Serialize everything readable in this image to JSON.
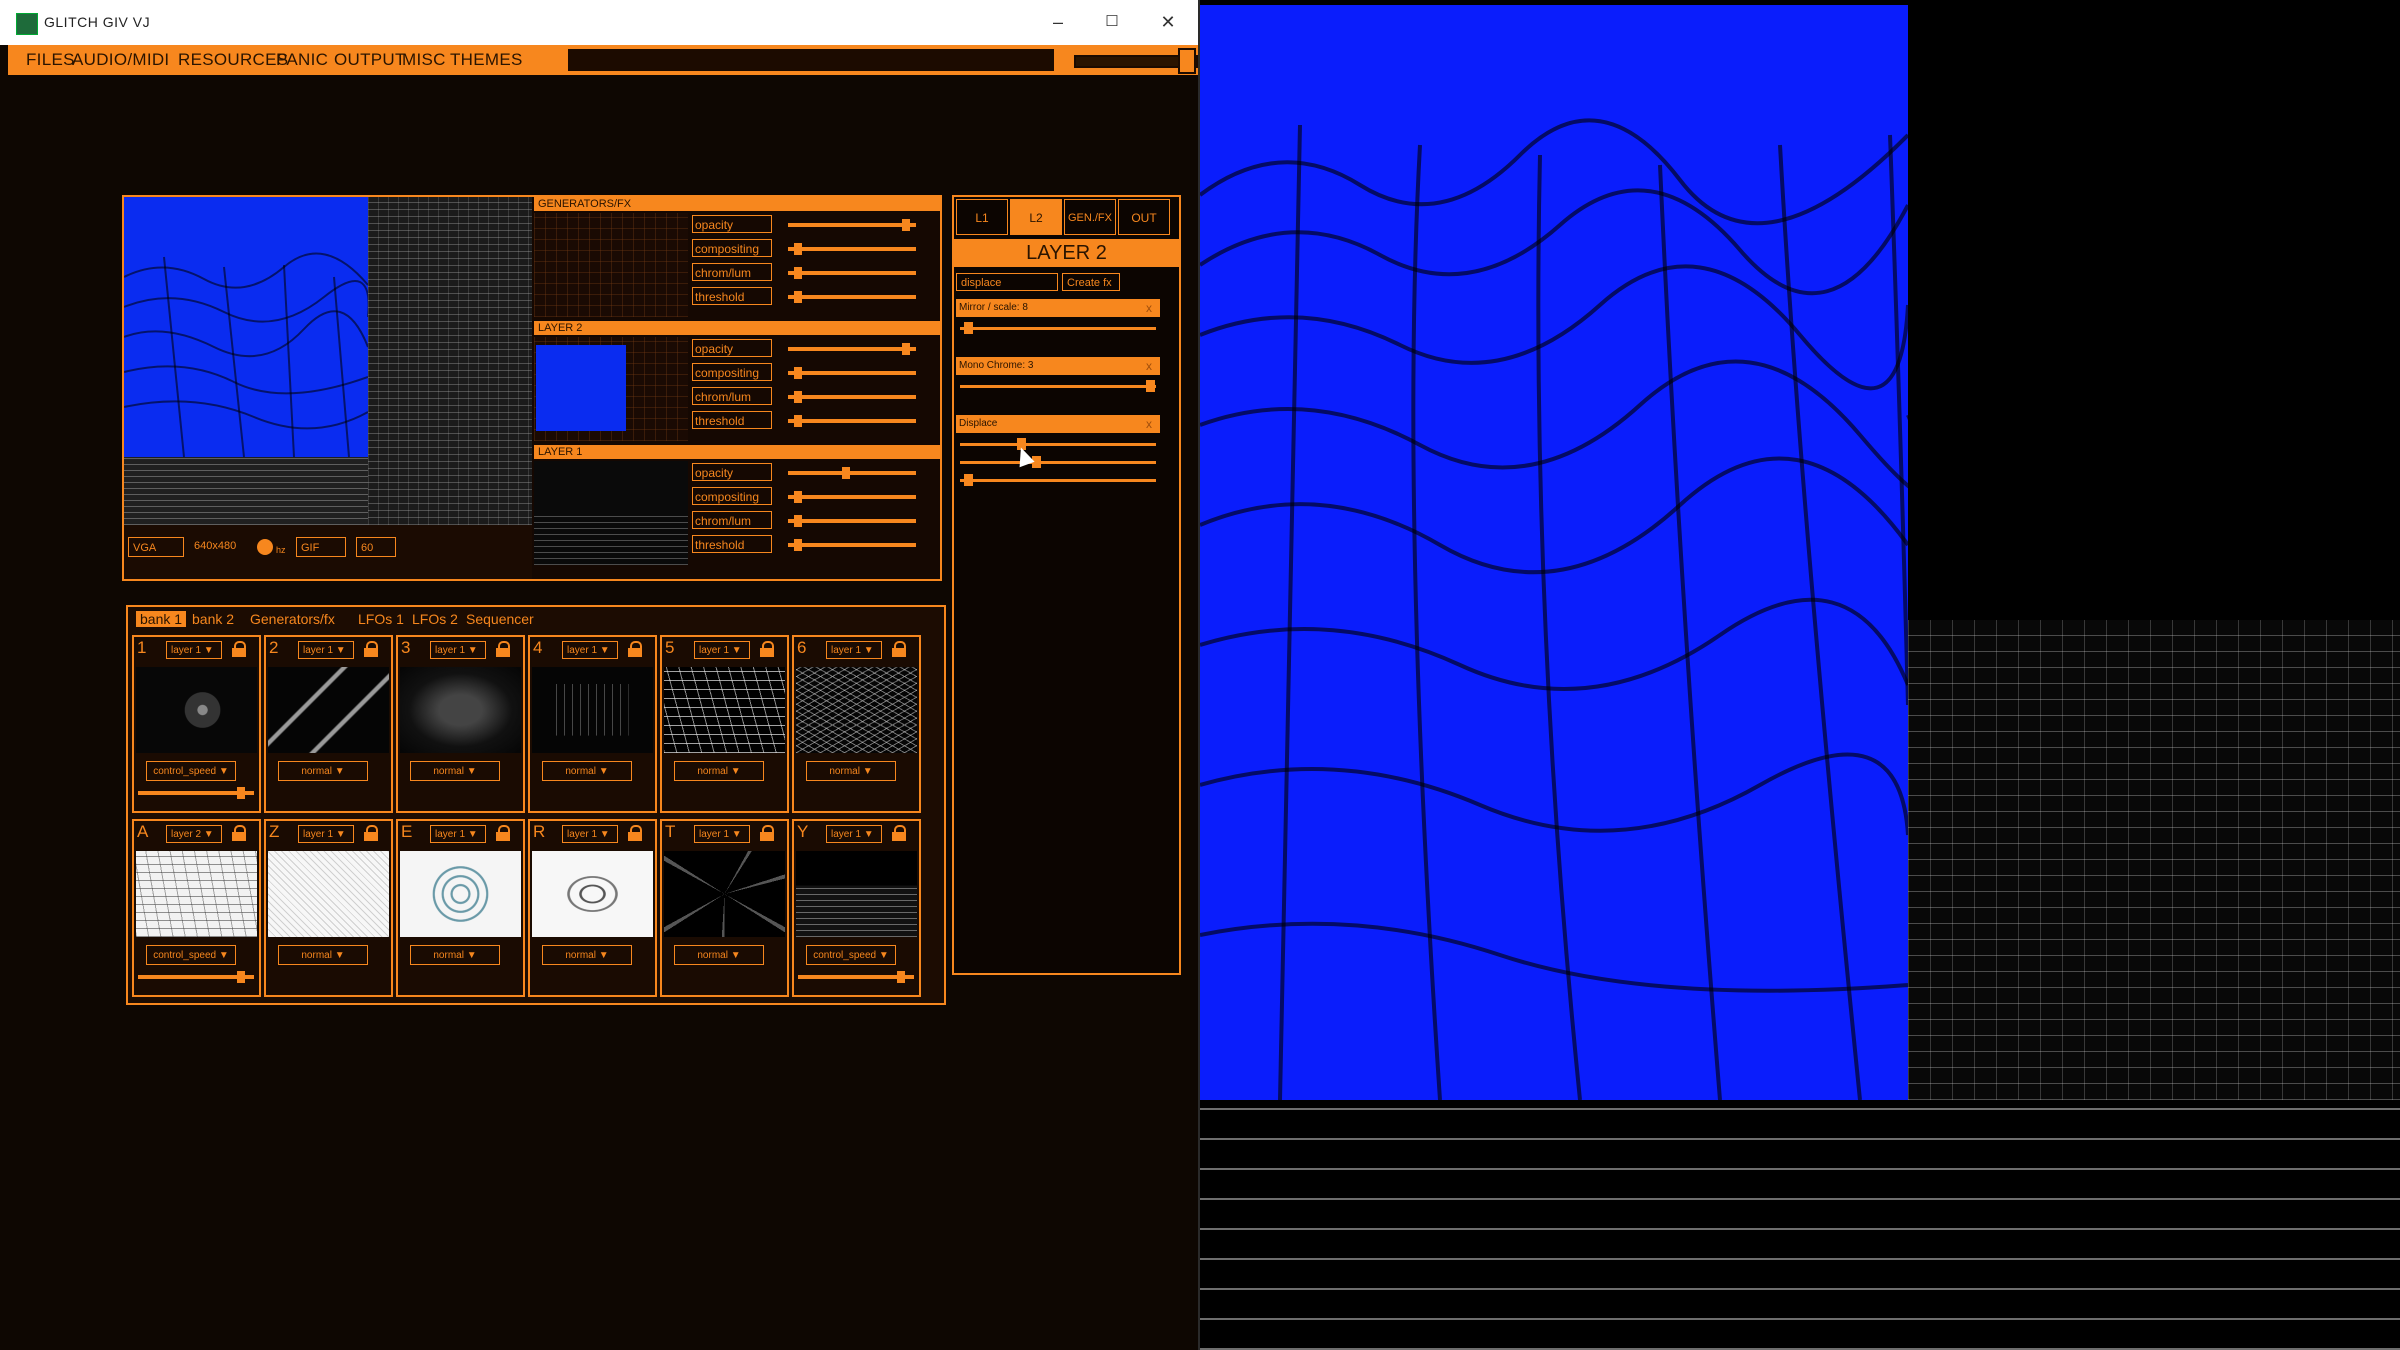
{
  "window": {
    "title": "GLITCH GIV VJ",
    "minimize": "–",
    "maximize": "☐",
    "close": "✕"
  },
  "menu": {
    "items": [
      "FILES",
      "AUDIO/MIDI",
      "RESOURCES",
      "PANIC",
      "OUTPUT",
      "MISC",
      "THEMES"
    ]
  },
  "preview": {
    "format": "VGA",
    "resolution": "640x480",
    "hz": "hz",
    "codec": "GIF",
    "fps": "60"
  },
  "mixer": {
    "sections": [
      {
        "name": "GENERATORS/FX",
        "params": [
          "opacity",
          "compositing",
          "chrom/lum",
          "threshold"
        ],
        "levels": [
          0.95,
          0.05,
          0.05,
          0.05
        ]
      },
      {
        "name": "LAYER 2",
        "params": [
          "opacity",
          "compositing",
          "chrom/lum",
          "threshold"
        ],
        "levels": [
          0.95,
          0.05,
          0.05,
          0.05
        ]
      },
      {
        "name": "LAYER 1",
        "params": [
          "opacity",
          "compositing",
          "chrom/lum",
          "threshold"
        ],
        "levels": [
          0.45,
          0.05,
          0.05,
          0.05
        ]
      }
    ]
  },
  "layer_panel": {
    "tabs": [
      "L1",
      "L2",
      "GEN./FX",
      "OUT"
    ],
    "active_tab": "L2",
    "title": "LAYER 2",
    "fx_select": "displace",
    "create_button": "Create fx",
    "effects": [
      {
        "name": "Mirror / scale: 8",
        "close": "x",
        "levels": [
          0.02
        ]
      },
      {
        "name": "Mono Chrome: 3",
        "close": "x",
        "levels": [
          0.98
        ]
      },
      {
        "name": "Displace",
        "close": "x",
        "levels": [
          0.3,
          0.38,
          0.02
        ]
      }
    ]
  },
  "bank": {
    "tabs": [
      "bank 1",
      "bank 2",
      "Generators/fx",
      "LFOs 1",
      "LFOs 2",
      "Sequencer"
    ],
    "active_tab": "bank 1",
    "cells": [
      {
        "key": "1",
        "layer": "layer 1",
        "mode": "control_speed",
        "has_slider": true,
        "slider_level": 0.92,
        "thumb": "cube-wire"
      },
      {
        "key": "2",
        "layer": "layer 1",
        "mode": "normal",
        "has_slider": false,
        "thumb": "plane-wire"
      },
      {
        "key": "3",
        "layer": "layer 1",
        "mode": "normal",
        "has_slider": false,
        "thumb": "glow-text"
      },
      {
        "key": "4",
        "layer": "layer 1",
        "mode": "normal",
        "has_slider": false,
        "thumb": "room-wire"
      },
      {
        "key": "5",
        "layer": "layer 1",
        "mode": "normal",
        "has_slider": false,
        "thumb": "perspective-grid"
      },
      {
        "key": "6",
        "layer": "layer 1",
        "mode": "normal",
        "has_slider": false,
        "thumb": "dense-grid"
      },
      {
        "key": "A",
        "layer": "layer 2",
        "mode": "control_speed",
        "has_slider": true,
        "slider_level": 0.92,
        "thumb": "white-terrain"
      },
      {
        "key": "Z",
        "layer": "layer 1",
        "mode": "normal",
        "has_slider": false,
        "thumb": "white-noise"
      },
      {
        "key": "E",
        "layer": "layer 1",
        "mode": "normal",
        "has_slider": false,
        "thumb": "white-sphere"
      },
      {
        "key": "R",
        "layer": "layer 1",
        "mode": "normal",
        "has_slider": false,
        "thumb": "white-torus"
      },
      {
        "key": "T",
        "layer": "layer 1",
        "mode": "normal",
        "has_slider": false,
        "thumb": "star-burst"
      },
      {
        "key": "Y",
        "layer": "layer 1",
        "mode": "control_speed",
        "has_slider": true,
        "slider_level": 0.92,
        "thumb": "dark-floor"
      }
    ]
  },
  "colors": {
    "accent": "#f7871e",
    "panel_bg": "#0e0702",
    "output_blue": "#0a1dfc"
  }
}
